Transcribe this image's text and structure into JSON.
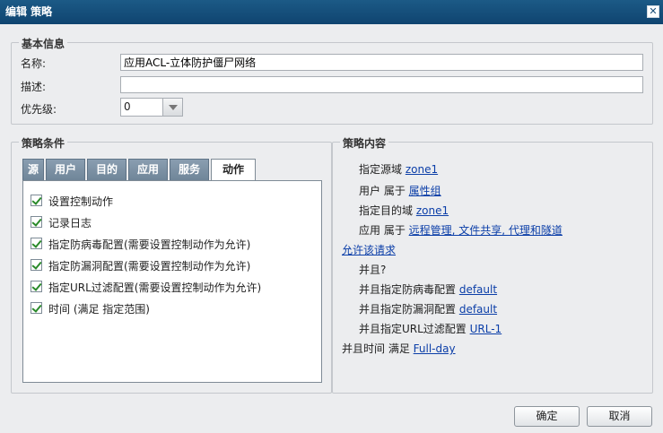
{
  "window": {
    "title": "编辑 策略",
    "close_glyph": "✕"
  },
  "basic": {
    "title": "基本信息",
    "name_label": "名称:",
    "name_value": "应用ACL-立体防护僵尸网络",
    "desc_label": "描述:",
    "desc_value": "",
    "priority_label": "优先级:",
    "priority_value": "0"
  },
  "conditions": {
    "title": "策略条件",
    "tabs": [
      {
        "label": "源"
      },
      {
        "label": "用户"
      },
      {
        "label": "目的"
      },
      {
        "label": "应用"
      },
      {
        "label": "服务"
      },
      {
        "label": "动作",
        "active": true
      }
    ],
    "actions": [
      {
        "label": "设置控制动作",
        "checked": true
      },
      {
        "label": "记录日志",
        "checked": true
      },
      {
        "label": "指定防病毒配置(需要设置控制动作为允许)",
        "checked": true
      },
      {
        "label": "指定防漏洞配置(需要设置控制动作为允许)",
        "checked": true
      },
      {
        "label": "指定URL过滤配置(需要设置控制动作为允许)",
        "checked": true
      },
      {
        "label": "时间 (满足 指定范围)",
        "checked": true
      }
    ]
  },
  "content": {
    "title": "策略内容",
    "src_zone": {
      "prefix": "指定源域 ",
      "link": "zone1"
    },
    "user": {
      "prefix": "用户 属于 ",
      "link": "属性组"
    },
    "dst_zone": {
      "prefix": "指定目的域 ",
      "link": "zone1"
    },
    "app": {
      "prefix": "应用 属于 ",
      "link": "远程管理, 文件共享, 代理和隧道"
    },
    "allow_link": "允许该请求",
    "and_q": "并且?",
    "av": {
      "prefix": "并且指定防病毒配置 ",
      "link": "default"
    },
    "vuln": {
      "prefix": "并且指定防漏洞配置 ",
      "link": "default"
    },
    "url": {
      "prefix": "并且指定URL过滤配置 ",
      "link": "URL-1"
    },
    "time": {
      "prefix": "并且时间 满足 ",
      "link": "Full-day"
    }
  },
  "buttons": {
    "ok": "确定",
    "cancel": "取消"
  },
  "colors": {
    "titlebar": "#0f4470",
    "link": "#0b3ea8",
    "tab": "#7a8fa2",
    "check": "#2a8a2a"
  }
}
